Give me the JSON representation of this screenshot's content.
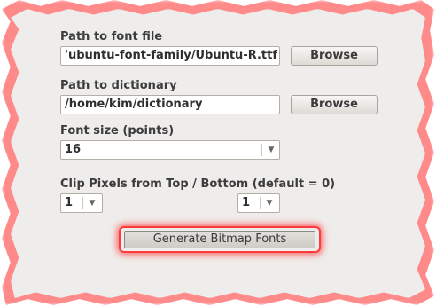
{
  "font_file": {
    "label": "Path to font file",
    "value": "'ubuntu-font-family/Ubuntu-R.ttf",
    "browse_label": "Browse"
  },
  "dictionary": {
    "label": "Path to dictionary",
    "value": "/home/kim/dictionary",
    "browse_label": "Browse"
  },
  "font_size": {
    "label": "Font size (points)",
    "value": "16"
  },
  "clip": {
    "label": "Clip Pixels from Top / Bottom (default = 0)",
    "top_value": "1",
    "bottom_value": "1"
  },
  "generate_label": "Generate Bitmap Fonts",
  "colors": {
    "panel": "#efedeb",
    "highlight": "#ff3030"
  },
  "icons": {
    "dropdown": "chevron-down-icon"
  }
}
